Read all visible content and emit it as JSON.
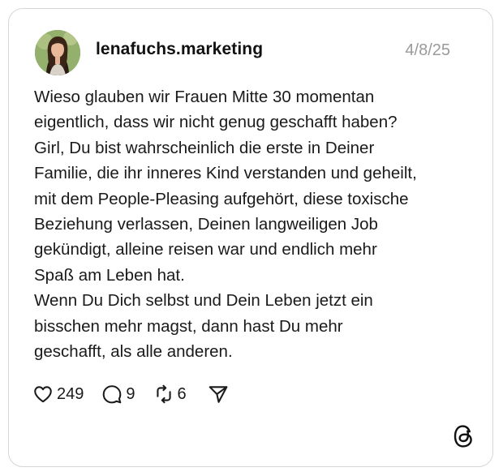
{
  "post": {
    "username": "lenafuchs.marketing",
    "date": "4/8/25",
    "text_lines": [
      "Wieso glauben wir Frauen Mitte 30 momentan",
      "eigentlich, dass wir nicht genug geschafft haben?",
      "Girl, Du bist wahrscheinlich die erste in Deiner",
      "Familie, die ihr inneres Kind verstanden und geheilt,",
      "mit dem People-Pleasing aufgehört, diese toxische",
      "Beziehung verlassen, Deinen langweiligen Job",
      "gekündigt, alleine reisen war und endlich mehr",
      "Spaß am Leben hat.",
      "Wenn Du Dich selbst und Dein Leben jetzt ein",
      "bisschen mehr magst, dann hast Du mehr",
      "geschafft, als alle anderen."
    ],
    "likes": "249",
    "comments": "9",
    "reposts": "6"
  },
  "icons": {
    "like": "heart-icon",
    "comment": "comment-bubble-icon",
    "repost": "repost-icon",
    "share": "send-icon",
    "logo": "threads-logo-icon"
  },
  "colors": {
    "background": "#ffffff",
    "border": "#d6d6d6",
    "text": "#1a1a1a",
    "muted": "#9a9a9a"
  }
}
